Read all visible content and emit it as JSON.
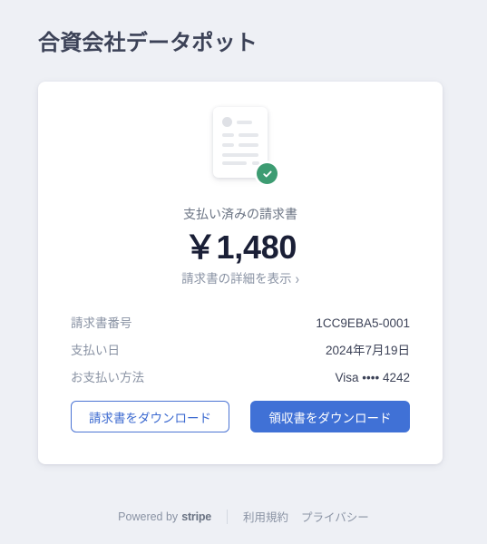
{
  "merchant": {
    "name": "合資会社データポット"
  },
  "invoice": {
    "icon_name": "paid-invoice-document-icon",
    "badge_icon_name": "green-check-badge-icon",
    "status_label": "支払い済みの請求書",
    "amount": "￥1,480",
    "details_link_label": "請求書の詳細を表示",
    "details_link_chevron": "›"
  },
  "details": {
    "rows": [
      {
        "label": "請求書番号",
        "value": "1CC9EBA5-0001"
      },
      {
        "label": "支払い日",
        "value": "2024年7月19日"
      },
      {
        "label": "お支払い方法",
        "value": "Visa •••• 4242"
      }
    ]
  },
  "actions": {
    "download_invoice_label": "請求書をダウンロード",
    "download_receipt_label": "領収書をダウンロード"
  },
  "footer": {
    "powered_by_label": "Powered by",
    "stripe_wordmark": "stripe",
    "links": [
      {
        "label": "利用規約"
      },
      {
        "label": "プライバシー"
      }
    ]
  },
  "colors": {
    "page_background": "#eef0f5",
    "card_background": "#ffffff",
    "primary_blue": "#4071d6",
    "outline_blue": "#3c6ad0",
    "success_green": "#3d9c72",
    "heading_text": "#3c4257",
    "muted_text": "#8a93a4",
    "amount_text": "#1a1f36"
  }
}
